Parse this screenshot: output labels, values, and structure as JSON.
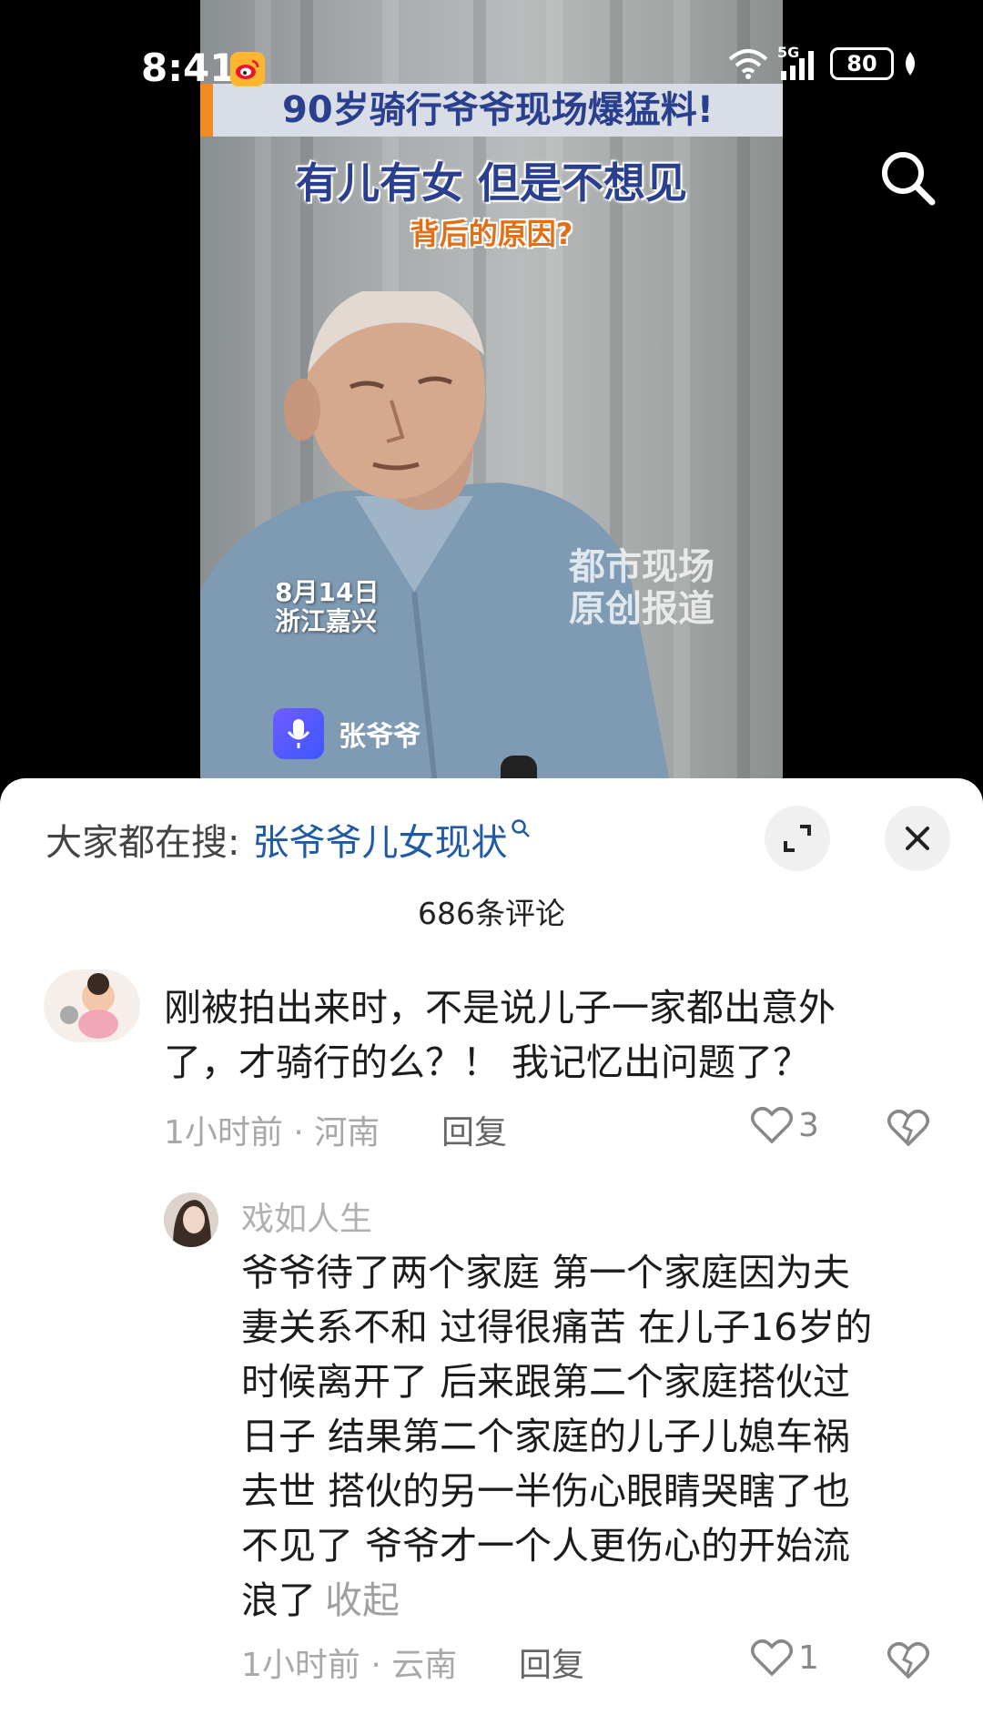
{
  "status_bar": {
    "time": "8:41",
    "battery": "80",
    "network": "5G"
  },
  "video": {
    "headline": "90岁骑行爷爷现场爆猛料!",
    "subhead": "有儿有女  但是不想见",
    "subhead_question": "背后的原因?",
    "date_line1": "8月14日",
    "date_line2": "浙江嘉兴",
    "watermark_line1": "都市现场",
    "watermark_line2": "原创报道",
    "speaker": "张爷爷"
  },
  "sheet": {
    "search_prefix": "大家都在搜:",
    "search_term": "张爷爷儿女现状",
    "comment_count": "686条评论"
  },
  "comments": [
    {
      "text_line1": "刚被拍出来时，不是说儿子一家都出意外",
      "text_line2": "了，才骑行的么？！ 我记忆出问题了？",
      "time": "1小时前",
      "location": "河南",
      "reply_label": "回复",
      "likes": "3"
    },
    {
      "author": "戏如人生",
      "lines": [
        "爷爷待了两个家庭 第一个家庭因为夫",
        "妻关系不和 过得很痛苦 在儿子16岁的",
        "时候离开了 后来跟第二个家庭搭伙过",
        "日子 结果第二个家庭的儿子儿媳车祸",
        "去世 搭伙的另一半伤心眼睛哭瞎了也",
        "不见了 爷爷才一个人更伤心的开始流",
        "浪了"
      ],
      "collapse_label": "收起",
      "time": "1小时前",
      "location": "云南",
      "reply_label": "回复",
      "likes": "1"
    }
  ],
  "colors": {
    "link_blue": "#1f5aa6",
    "headline_blue": "#2b3f8f",
    "accent_orange": "#f08a22"
  },
  "icons": [
    "weibo-icon",
    "wifi-icon",
    "signal-icon",
    "battery-icon",
    "search-icon",
    "mic-icon",
    "expand-icon",
    "close-icon",
    "heart-icon",
    "broken-heart-icon"
  ]
}
